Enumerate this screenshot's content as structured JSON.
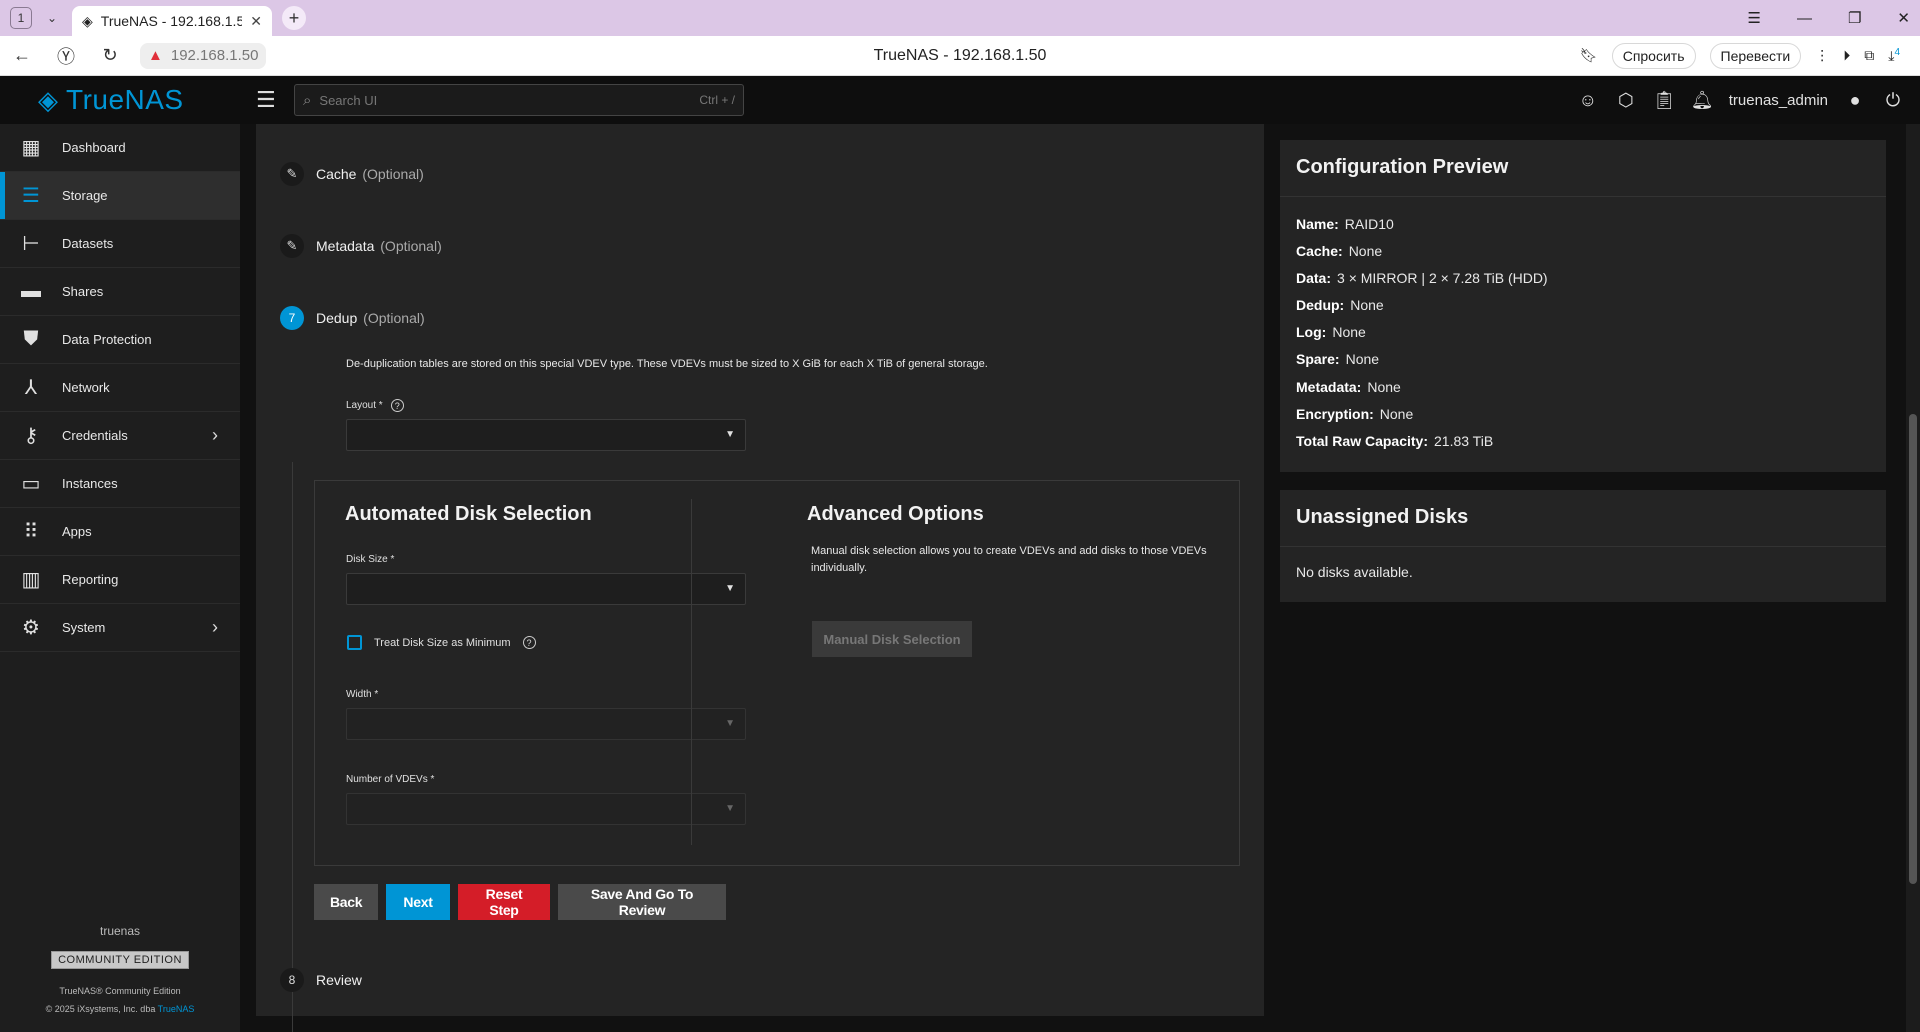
{
  "browser": {
    "tab_count": "1",
    "tab_title": "TrueNAS - 192.168.1.50",
    "address": "192.168.1.50",
    "page_title": "TrueNAS - 192.168.1.50",
    "ask_label": "Спросить",
    "translate_label": "Перевести",
    "download_badge": "4"
  },
  "topbar": {
    "brand": "TrueNAS",
    "search_placeholder": "Search UI",
    "search_shortcut": "Ctrl + /",
    "username": "truenas_admin"
  },
  "sidebar": {
    "items": [
      {
        "label": "Dashboard"
      },
      {
        "label": "Storage"
      },
      {
        "label": "Datasets"
      },
      {
        "label": "Shares"
      },
      {
        "label": "Data Protection"
      },
      {
        "label": "Network"
      },
      {
        "label": "Credentials"
      },
      {
        "label": "Instances"
      },
      {
        "label": "Apps"
      },
      {
        "label": "Reporting"
      },
      {
        "label": "System"
      }
    ],
    "hostname": "truenas",
    "edition": "COMMUNITY EDITION",
    "product": "TrueNAS® Community Edition",
    "copyright": "© 2025 iXsystems, Inc. dba",
    "copyright_link": "TrueNAS"
  },
  "wizard": {
    "steps": [
      {
        "title": "Cache",
        "optional": "(Optional)"
      },
      {
        "title": "Metadata",
        "optional": "(Optional)"
      },
      {
        "number": "7",
        "title": "Dedup",
        "optional": "(Optional)"
      },
      {
        "number": "8",
        "title": "Review"
      }
    ],
    "dedup": {
      "description": "De-duplication tables are stored on this special VDEV type. These VDEVs must be sized to X GiB for each X TiB of general storage.",
      "layout_label": "Layout *",
      "automated_title": "Automated Disk Selection",
      "disk_size_label": "Disk Size *",
      "treat_min_label": "Treat Disk Size as Minimum",
      "width_label": "Width *",
      "num_vdevs_label": "Number of VDEVs *",
      "advanced_title": "Advanced Options",
      "advanced_desc": "Manual disk selection allows you to create VDEVs and add disks to those VDEVs individually.",
      "manual_button": "Manual Disk Selection"
    },
    "buttons": {
      "back": "Back",
      "next": "Next",
      "reset": "Reset Step",
      "review": "Save And Go To Review"
    }
  },
  "preview": {
    "title": "Configuration Preview",
    "rows": [
      {
        "key": "Name:",
        "value": "RAID10"
      },
      {
        "key": "Cache:",
        "value": "None"
      },
      {
        "key": "Data:",
        "value": "3 × MIRROR | 2 × 7.28 TiB (HDD)"
      },
      {
        "key": "Dedup:",
        "value": "None"
      },
      {
        "key": "Log:",
        "value": "None"
      },
      {
        "key": "Spare:",
        "value": "None"
      },
      {
        "key": "Metadata:",
        "value": "None"
      },
      {
        "key": "Encryption:",
        "value": "None"
      },
      {
        "key": "Total Raw Capacity:",
        "value": "21.83 TiB"
      }
    ]
  },
  "unassigned": {
    "title": "Unassigned Disks",
    "empty": "No disks available."
  },
  "colors": {
    "accent": "#0095d5",
    "danger": "#d41d28"
  }
}
